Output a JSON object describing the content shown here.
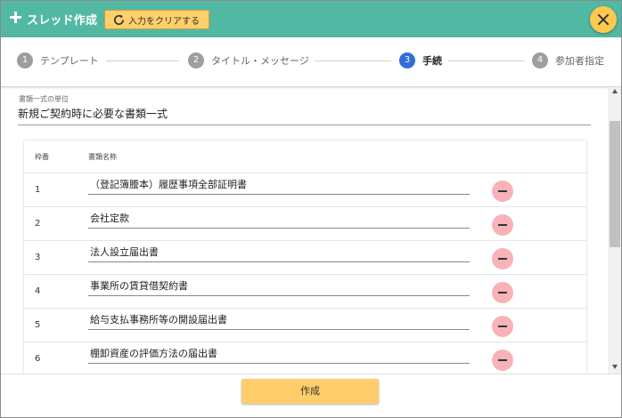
{
  "header": {
    "title": "スレッド作成",
    "clear_button_label": "入力をクリアする",
    "accent_color": "#52b8a3"
  },
  "stepper": {
    "steps": [
      {
        "number": "1",
        "label": "テンプレート",
        "active": false
      },
      {
        "number": "2",
        "label": "タイトル・メッセージ",
        "active": false
      },
      {
        "number": "3",
        "label": "手続",
        "active": true
      },
      {
        "number": "4",
        "label": "参加者指定",
        "active": false
      }
    ]
  },
  "form": {
    "unit_label": "書類一式の単位",
    "unit_value": "新規ご契約時に必要な書類一式"
  },
  "table": {
    "headers": {
      "number": "枠番",
      "name": "書類名称"
    },
    "rows": [
      {
        "number": "1",
        "name": "（登記簿謄本）履歴事項全部証明書"
      },
      {
        "number": "2",
        "name": "会社定款"
      },
      {
        "number": "3",
        "name": "法人設立届出書"
      },
      {
        "number": "4",
        "name": "事業所の賃貸借契約書"
      },
      {
        "number": "5",
        "name": "給与支払事務所等の開設届出書"
      },
      {
        "number": "6",
        "name": "棚卸資産の評価方法の届出書"
      }
    ]
  },
  "footer": {
    "create_label": "作成"
  }
}
